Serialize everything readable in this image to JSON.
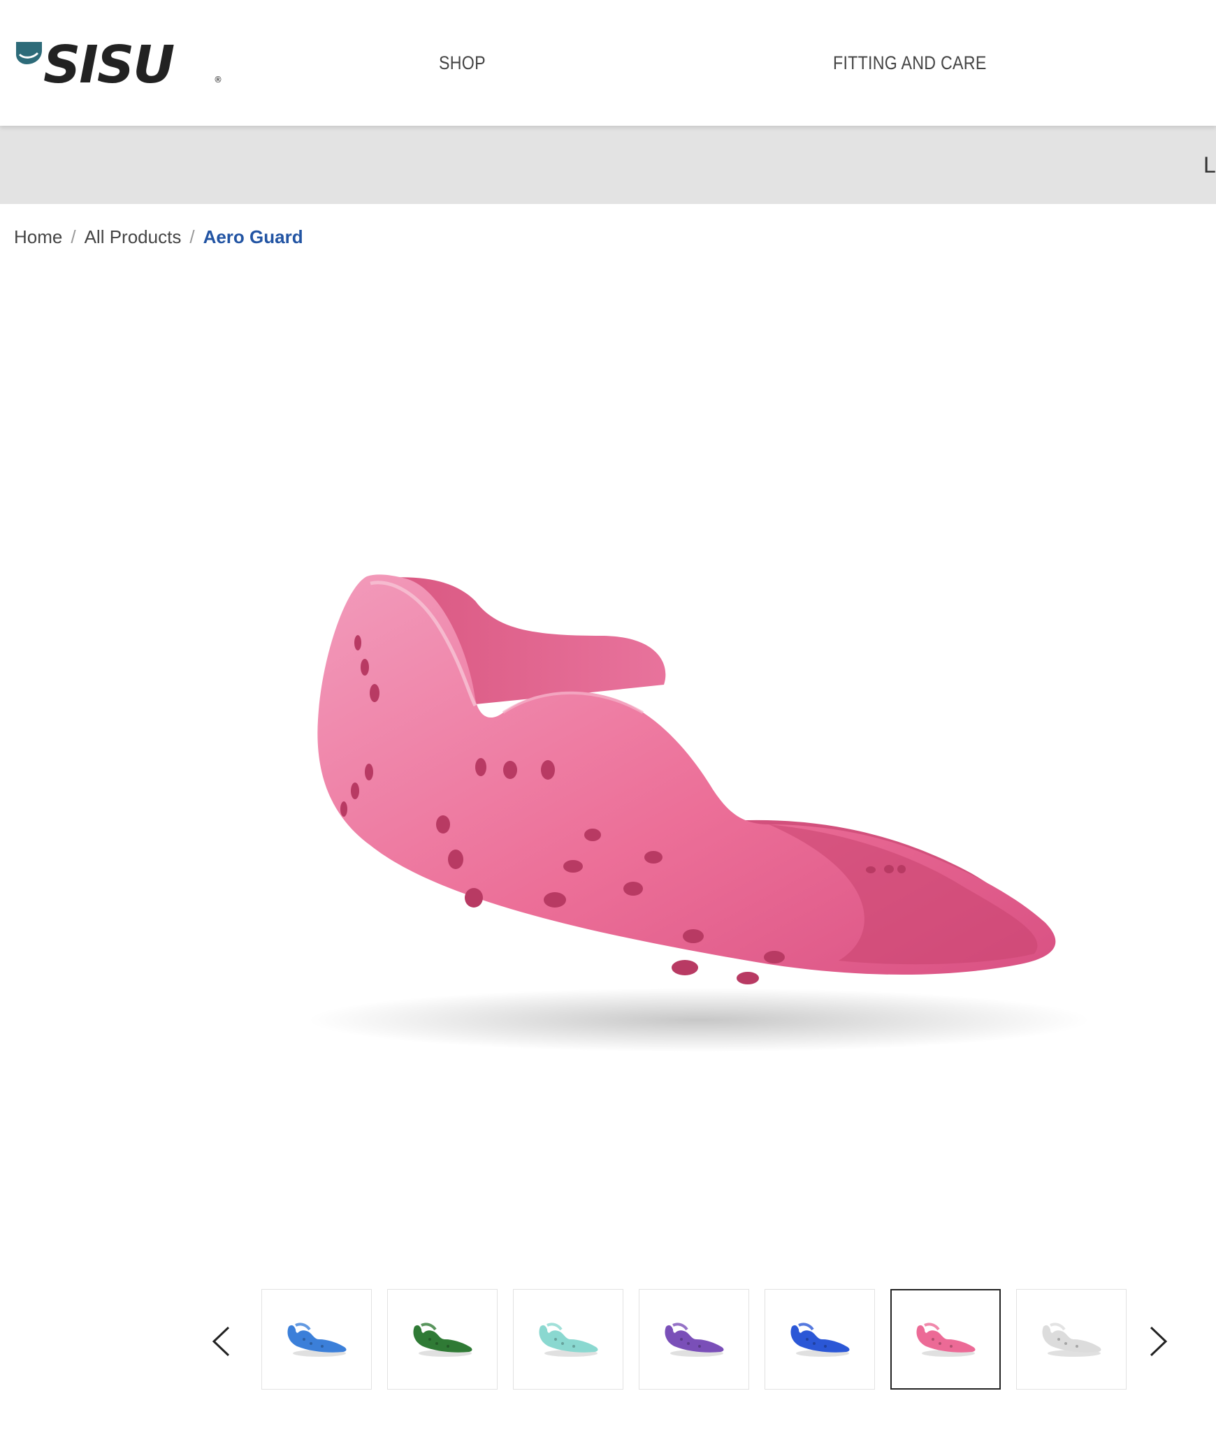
{
  "header": {
    "logo_text": "SISU",
    "nav": [
      {
        "label": "SHOP"
      },
      {
        "label": "FITTING AND CARE"
      }
    ]
  },
  "announcement": {
    "text": "L"
  },
  "breadcrumb": {
    "items": [
      "Home",
      "All Products"
    ],
    "current": "Aero Guard",
    "separator": "/"
  },
  "product": {
    "selected_color": "#ec6a96"
  },
  "gallery": {
    "prev_icon": "chevron-left-icon",
    "next_icon": "chevron-right-icon",
    "thumbnails": [
      {
        "color": "#3b7fd9"
      },
      {
        "color": "#2f7a35"
      },
      {
        "color": "#8ad8d0"
      },
      {
        "color": "#7a4fb8"
      },
      {
        "color": "#2b57d6"
      },
      {
        "color": "#ec6a96",
        "selected": true
      },
      {
        "color": "#dcdcdc"
      }
    ]
  },
  "colors": {
    "logo_accent": "#2d6b79",
    "logo_text": "#222222",
    "breadcrumb_current": "#2254a3",
    "announce_bg": "#e3e3e3"
  }
}
